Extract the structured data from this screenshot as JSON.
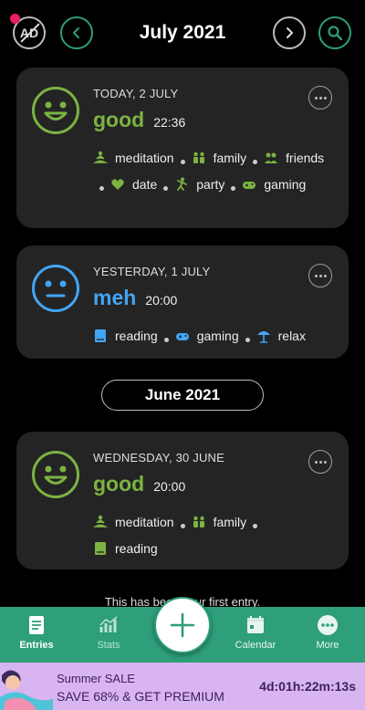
{
  "header": {
    "ad_label": "AD",
    "month_title": "July 2021"
  },
  "entries": [
    {
      "date": "TODAY, 2 JULY",
      "mood": "good",
      "time": "22:36",
      "activities": [
        "meditation",
        "family",
        "friends",
        "date",
        "party",
        "gaming"
      ]
    },
    {
      "date": "YESTERDAY, 1 JULY",
      "mood": "meh",
      "time": "20:00",
      "activities": [
        "reading",
        "gaming",
        "relax"
      ]
    },
    {
      "date": "WEDNESDAY, 30 JUNE",
      "mood": "good",
      "time": "20:00",
      "activities": [
        "meditation",
        "family",
        "reading"
      ]
    }
  ],
  "month_divider": "June 2021",
  "first_entry_note": "This has been your first entry.",
  "bottom_nav": {
    "entries": "Entries",
    "stats": "Stats",
    "calendar": "Calendar",
    "more": "More"
  },
  "promo": {
    "title": "Summer SALE",
    "subtitle": "SAVE 68% & GET PREMIUM",
    "timer": "4d:01h:22m:13s"
  },
  "colors": {
    "accent": "#2e9e7b",
    "good": "#7cb342",
    "meh": "#42a5f5",
    "card": "#242424",
    "promo_bg": "#d8b4f0"
  }
}
